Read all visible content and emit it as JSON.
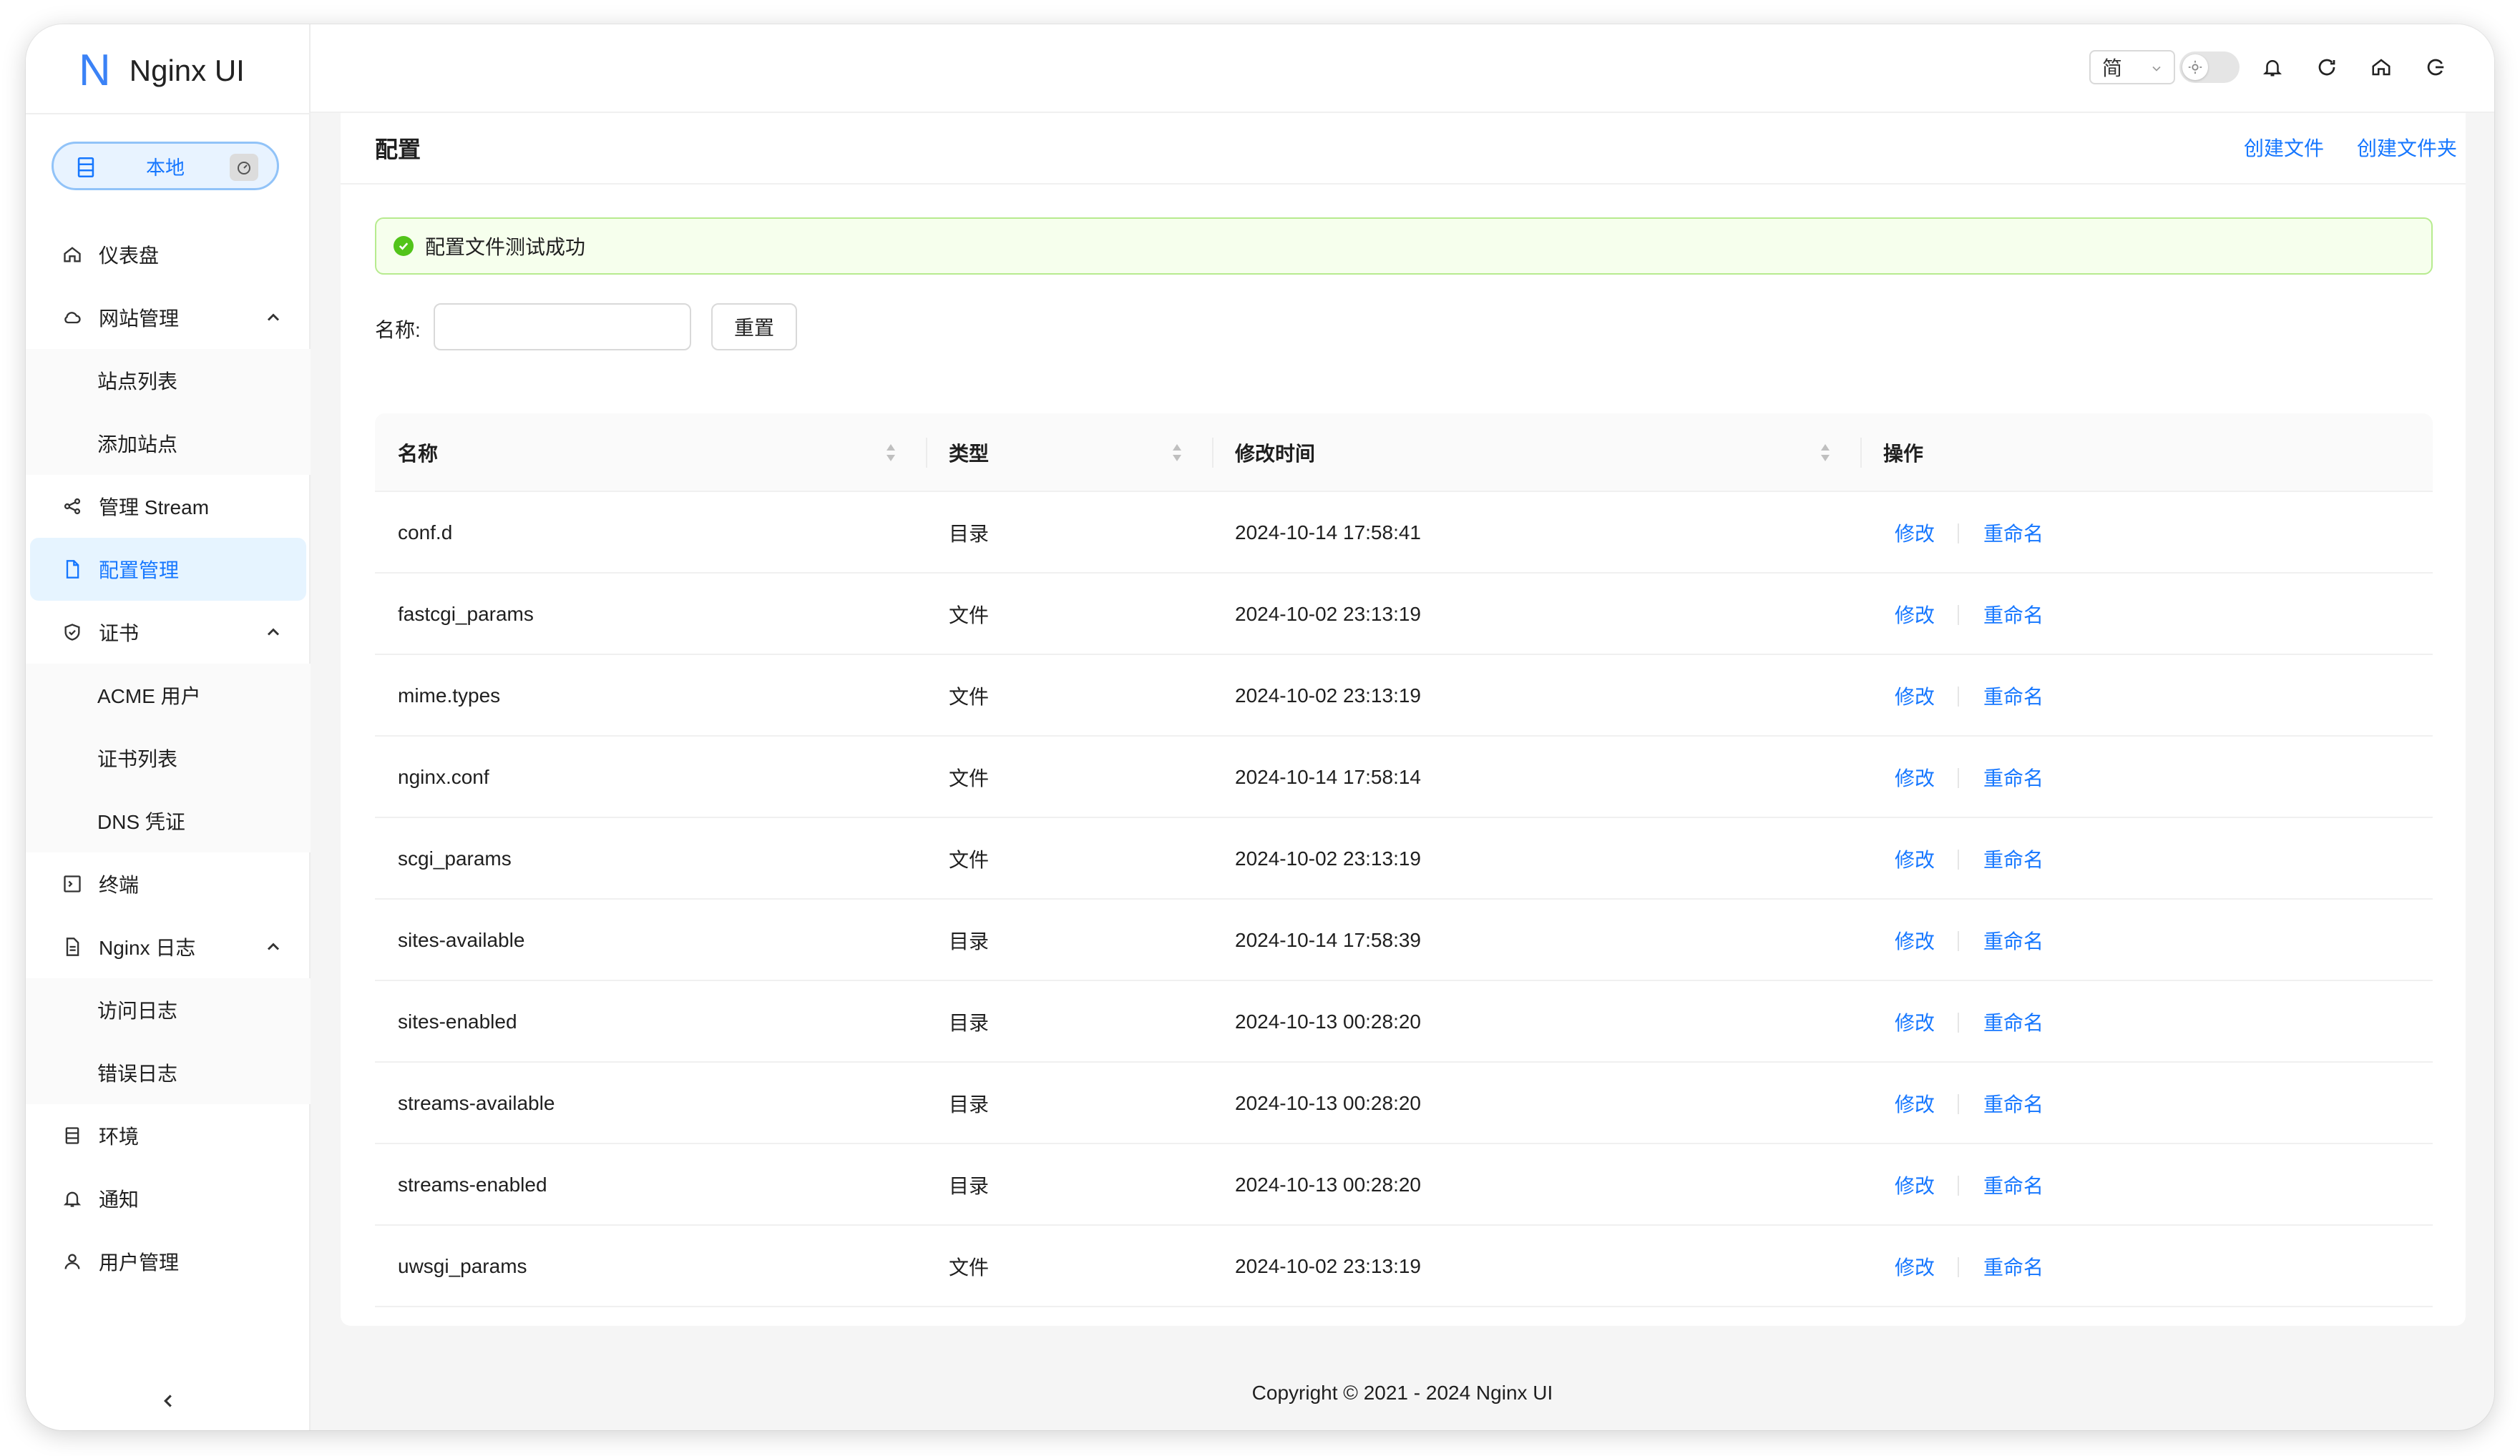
{
  "app": {
    "logo_mark": "N",
    "name": "Nginx UI"
  },
  "environment": {
    "label": "本地"
  },
  "sidebar": {
    "items": [
      {
        "key": "dashboard",
        "label": "仪表盘"
      },
      {
        "key": "sites",
        "label": "网站管理"
      },
      {
        "key": "site-list",
        "label": "站点列表"
      },
      {
        "key": "add-site",
        "label": "添加站点"
      },
      {
        "key": "stream",
        "label": "管理 Stream"
      },
      {
        "key": "config",
        "label": "配置管理"
      },
      {
        "key": "cert",
        "label": "证书"
      },
      {
        "key": "acme",
        "label": "ACME 用户"
      },
      {
        "key": "cert-list",
        "label": "证书列表"
      },
      {
        "key": "dns",
        "label": "DNS 凭证"
      },
      {
        "key": "terminal",
        "label": "终端"
      },
      {
        "key": "nginx-log",
        "label": "Nginx 日志"
      },
      {
        "key": "access-log",
        "label": "访问日志"
      },
      {
        "key": "error-log",
        "label": "错误日志"
      },
      {
        "key": "env",
        "label": "环境"
      },
      {
        "key": "notify",
        "label": "通知"
      },
      {
        "key": "users",
        "label": "用户管理"
      }
    ]
  },
  "header": {
    "lang": "简"
  },
  "page": {
    "title": "配置",
    "create_file": "创建文件",
    "create_folder": "创建文件夹",
    "alert": "配置文件测试成功",
    "filter_label": "名称:",
    "filter_value": "",
    "reset": "重置"
  },
  "table": {
    "columns": [
      "名称",
      "类型",
      "修改时间",
      "操作"
    ],
    "edit_label": "修改",
    "rename_label": "重命名",
    "rows": [
      {
        "name": "conf.d",
        "type": "目录",
        "mtime": "2024-10-14 17:58:41"
      },
      {
        "name": "fastcgi_params",
        "type": "文件",
        "mtime": "2024-10-02 23:13:19"
      },
      {
        "name": "mime.types",
        "type": "文件",
        "mtime": "2024-10-02 23:13:19"
      },
      {
        "name": "nginx.conf",
        "type": "文件",
        "mtime": "2024-10-14 17:58:14"
      },
      {
        "name": "scgi_params",
        "type": "文件",
        "mtime": "2024-10-02 23:13:19"
      },
      {
        "name": "sites-available",
        "type": "目录",
        "mtime": "2024-10-14 17:58:39"
      },
      {
        "name": "sites-enabled",
        "type": "目录",
        "mtime": "2024-10-13 00:28:20"
      },
      {
        "name": "streams-available",
        "type": "目录",
        "mtime": "2024-10-13 00:28:20"
      },
      {
        "name": "streams-enabled",
        "type": "目录",
        "mtime": "2024-10-13 00:28:20"
      },
      {
        "name": "uwsgi_params",
        "type": "文件",
        "mtime": "2024-10-02 23:13:19"
      }
    ]
  },
  "footer": "Copyright © 2021 - 2024 Nginx UI",
  "colors": {
    "accent": "#1677ff",
    "success": "#52c41a",
    "active_bg": "#e6f4ff"
  }
}
